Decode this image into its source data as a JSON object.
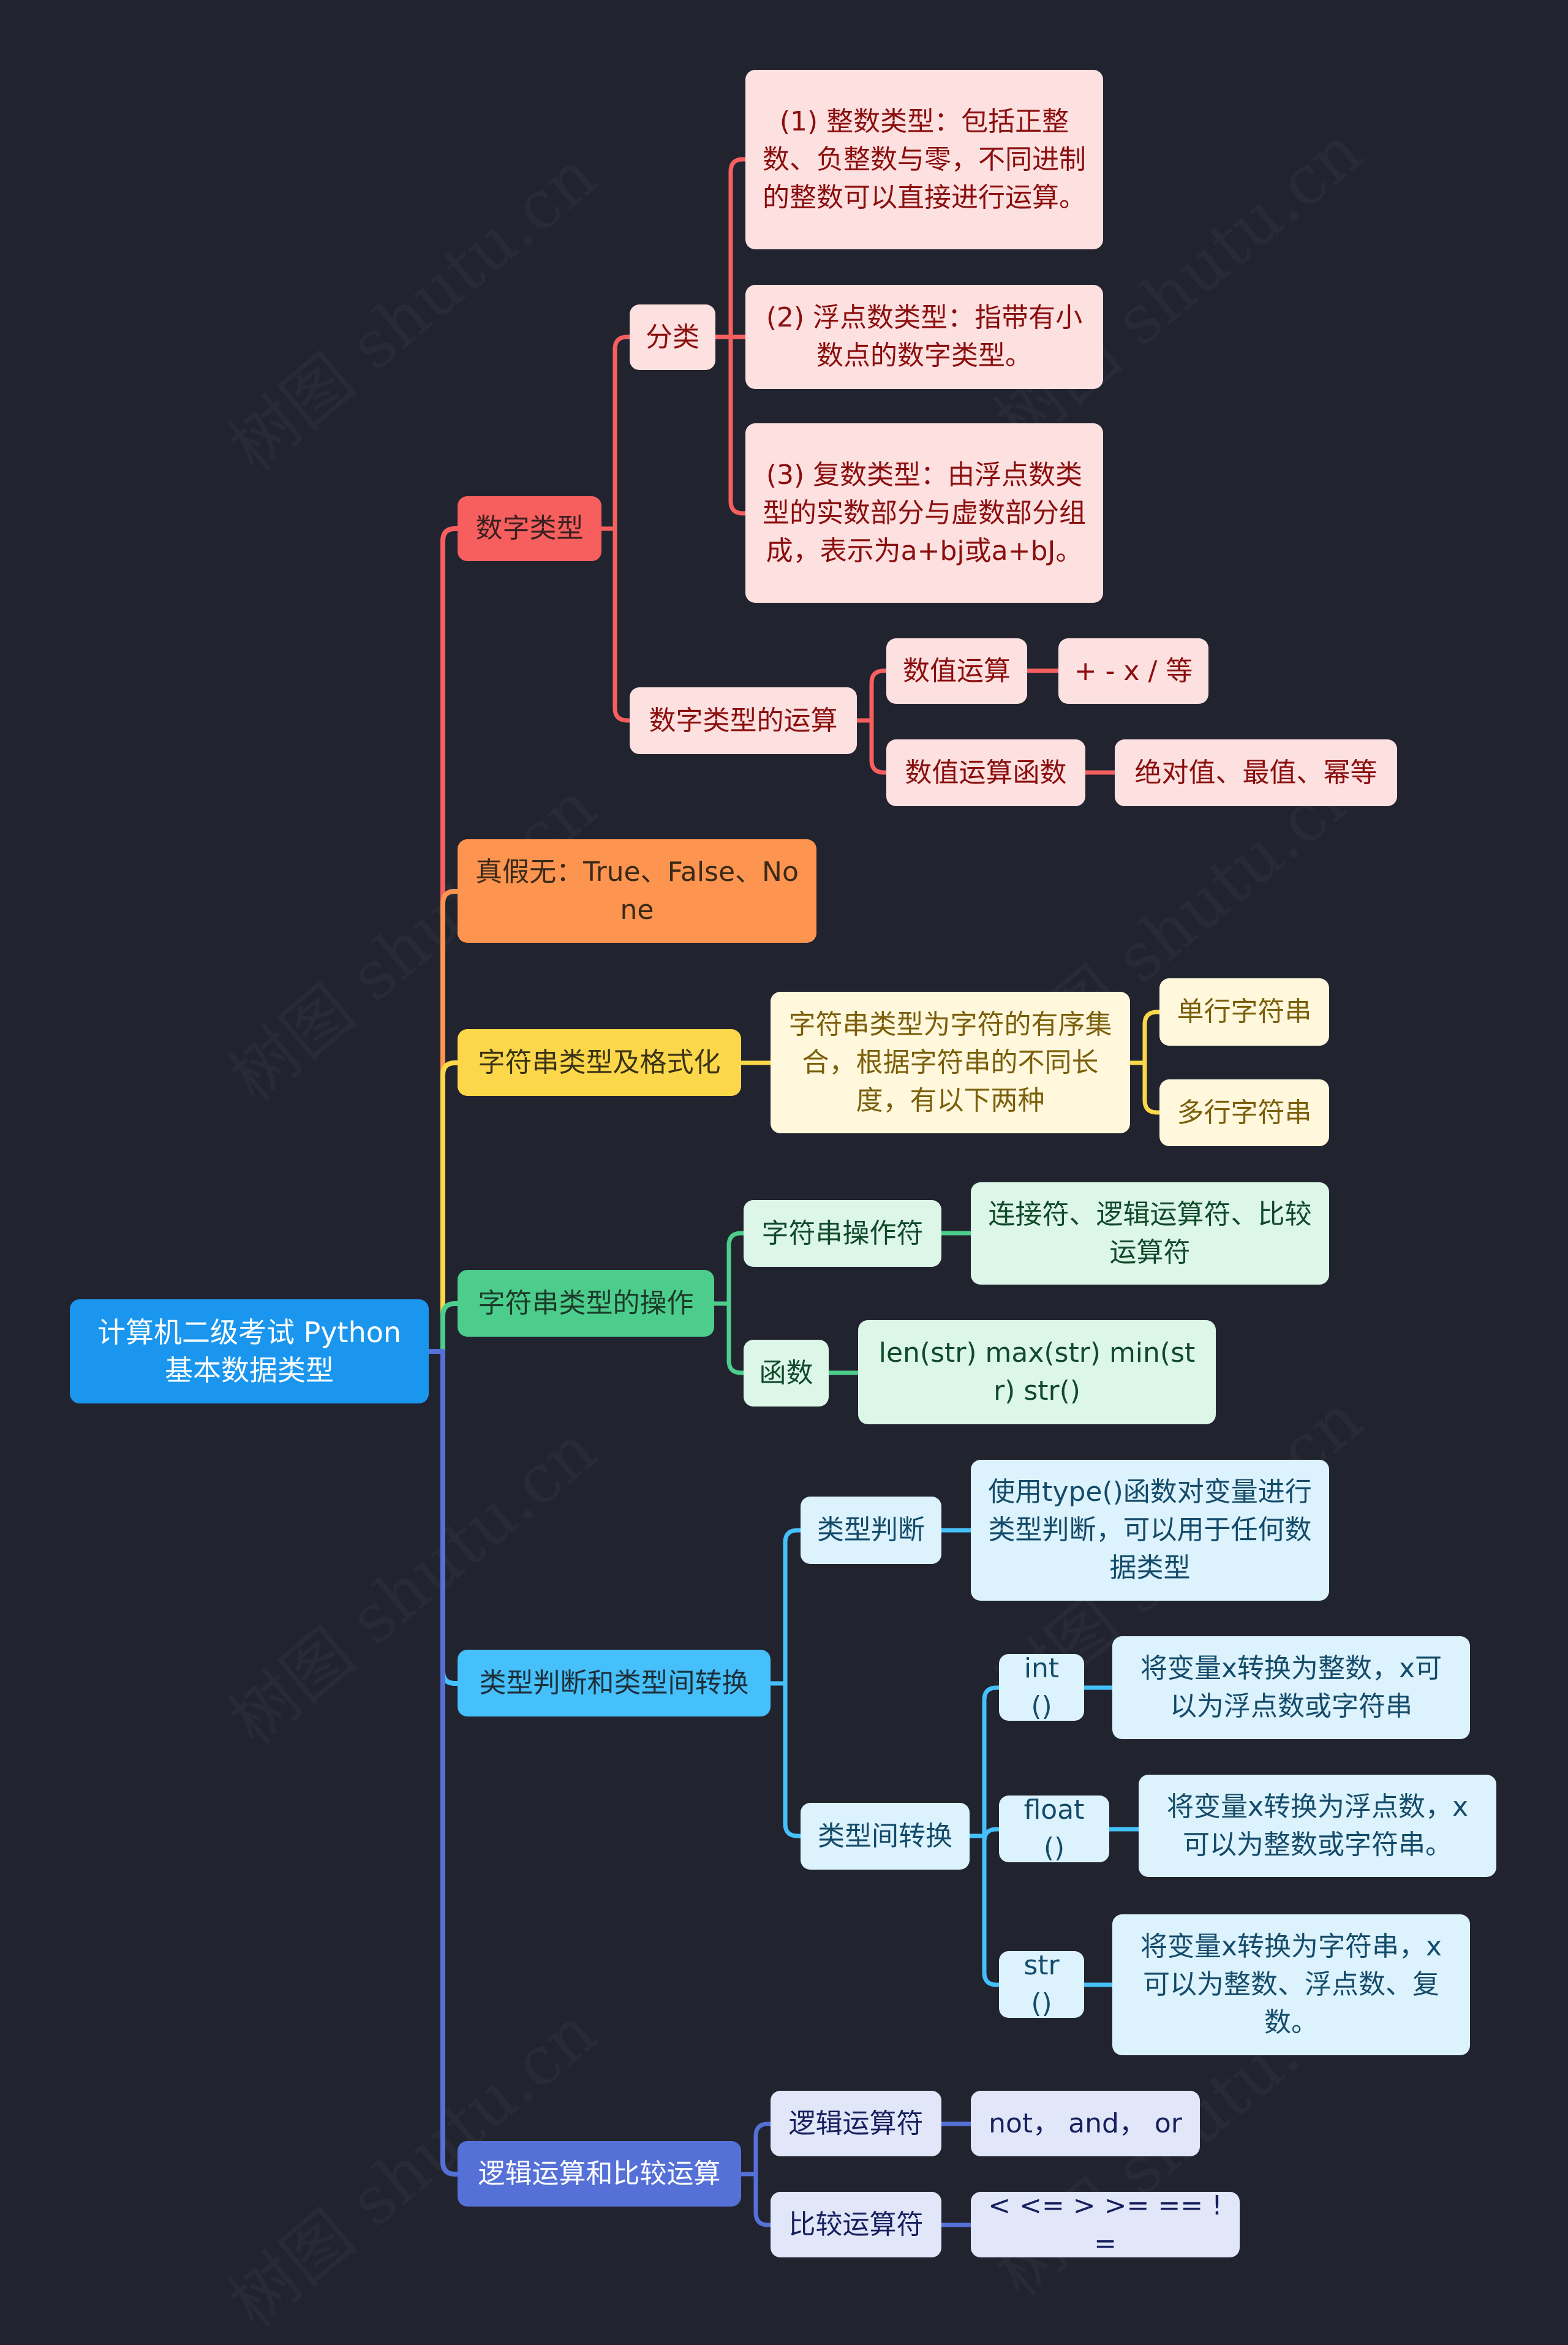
{
  "watermark": "树图 shutu.cn",
  "colors": {
    "background": "#21232f",
    "root": "#1a96ee",
    "red": "#f75f5f",
    "orange": "#fd944f",
    "yellow": "#fcd74a",
    "green": "#4ccd8c",
    "cyan": "#45c0fa",
    "indigo": "#5570d6"
  },
  "root": {
    "label": "计算机二级考试 Python 基本数据类型"
  },
  "branches": {
    "number": {
      "label": "数字类型",
      "classify": {
        "label": "分类",
        "items": [
          "(1) 整数类型：包括正整数、负整数与零，不同进制的整数可以直接进行运算。",
          "(2) 浮点数类型：指带有小数点的数字类型。",
          "(3) 复数类型：由浮点数类型的实数部分与虚数部分组成，表示为a+bj或a+bJ。"
        ]
      },
      "ops": {
        "label": "数字类型的运算",
        "numeric": {
          "label": "数值运算",
          "value": "+ - x / 等"
        },
        "functions": {
          "label": "数值运算函数",
          "value": "绝对值、最值、幂等"
        }
      }
    },
    "bool": {
      "label": "真假无：True、False、None"
    },
    "string_format": {
      "label": "字符串类型及格式化",
      "desc": "字符串类型为字符的有序集合，根据字符串的不同长度，有以下两种",
      "kinds": [
        "单行字符串",
        "多行字符串"
      ]
    },
    "string_ops": {
      "label": "字符串类型的操作",
      "operators": {
        "label": "字符串操作符",
        "value": "连接符、逻辑运算符、比较运算符"
      },
      "functions": {
        "label": "函数",
        "value": "len(str) max(str) min(str) str()"
      }
    },
    "type": {
      "label": "类型判断和类型间转换",
      "check": {
        "label": "类型判断",
        "value": "使用type()函数对变量进行类型判断，可以用于任何数据类型"
      },
      "convert": {
        "label": "类型间转换",
        "items": [
          {
            "func": "int()",
            "desc": "将变量x转换为整数，x可以为浮点数或字符串"
          },
          {
            "func": "float()",
            "desc": "将变量x转换为浮点数，x可以为整数或字符串。"
          },
          {
            "func": "str()",
            "desc": "将变量x转换为字符串，x可以为整数、浮点数、复数。"
          }
        ]
      }
    },
    "logic": {
      "label": "逻辑运算和比较运算",
      "logical": {
        "label": "逻辑运算符",
        "value": "not， and， or"
      },
      "compare": {
        "label": "比较运算符",
        "value": "< <= > >= == !="
      }
    }
  }
}
